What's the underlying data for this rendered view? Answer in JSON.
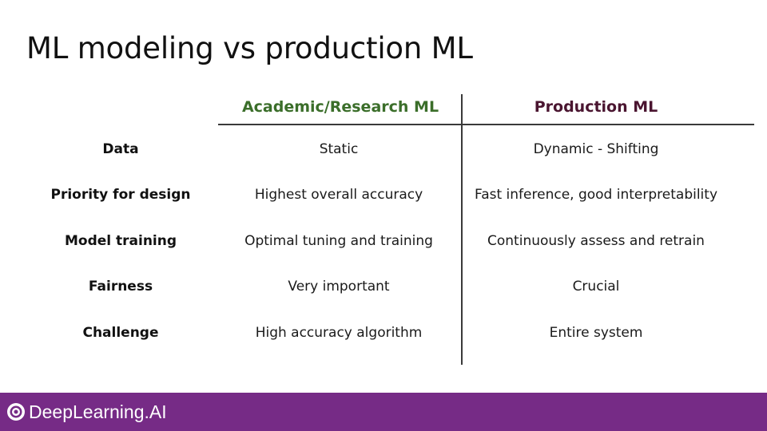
{
  "slide": {
    "title": "ML modeling vs production ML"
  },
  "table": {
    "headers": {
      "academic": "Academic/Research ML",
      "production": "Production ML"
    },
    "header_colors": {
      "academic": "#3b6e2a",
      "production": "#4a1530"
    },
    "rows": [
      {
        "label": "Data",
        "academic": "Static",
        "production": "Dynamic - Shifting"
      },
      {
        "label": "Priority for design",
        "academic": "Highest overall accuracy",
        "production": "Fast inference, good interpretability"
      },
      {
        "label": "Model training",
        "academic": "Optimal tuning and training",
        "production": "Continuously assess and retrain"
      },
      {
        "label": "Fairness",
        "academic": "Very important",
        "production": "Crucial"
      },
      {
        "label": "Challenge",
        "academic": "High accuracy algorithm",
        "production": "Entire system"
      }
    ]
  },
  "footer": {
    "brand": "DeepLearning.AI",
    "logo_icon": "deeplearning-ai-logo-icon",
    "background_color": "#762b86"
  }
}
